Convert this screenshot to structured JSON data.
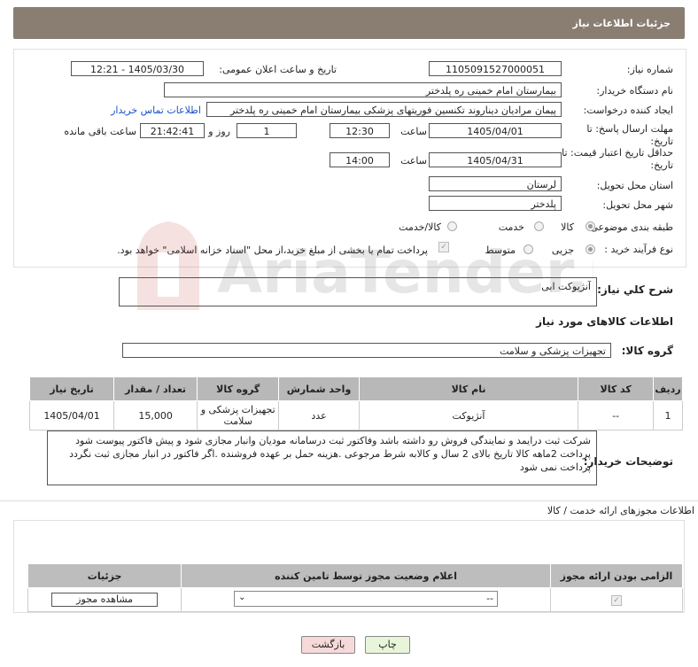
{
  "header": {
    "title": "جزئیات اطلاعات نیاز"
  },
  "fields": {
    "need_number_label": "شماره نیاز:",
    "need_number": "1105091527000051",
    "announce_label": "تاریخ و ساعت اعلان عمومی:",
    "announce_value": "1405/03/30 - 12:21",
    "buyer_org_label": "نام دستگاه خریدار:",
    "buyer_org": "بیمارستان امام خمینی ره پلدختر",
    "creator_label": "ایجاد کننده درخواست:",
    "creator": "پیمان مرادیان دیناروند تکنسین فوریتهای پزشکی بیمارستان امام خمینی ره پلدختر",
    "contact_link": "اطلاعات تماس خریدار",
    "deadline_label": "مهلت ارسال پاسخ: تا تاریخ:",
    "deadline_date": "1405/04/01",
    "time_label": "ساعت",
    "deadline_time": "12:30",
    "days": "1",
    "days_label": "روز و",
    "remaining_time": "21:42:41",
    "remaining_label": "ساعت باقی مانده",
    "price_validity_label": "حداقل تاریخ اعتبار قیمت: تا تاریخ:",
    "validity_date": "1405/04/31",
    "validity_time": "14:00",
    "province_label": "استان محل تحویل:",
    "province": "لرستان",
    "city_label": "شهر محل تحویل:",
    "city": "پلدختر",
    "category_label": "طبقه بندی موضوعی:",
    "category_options": [
      "کالا",
      "خدمت",
      "کالا/خدمت"
    ],
    "process_label": "نوع فرآیند خرید :",
    "process_options": [
      "جزیی",
      "متوسط"
    ],
    "payment_note": "پرداخت تمام یا بخشی از مبلغ خرید،از محل \"اسناد خزانه اسلامی\" خواهد بود."
  },
  "summary": {
    "label": "شرح کلي نياز:",
    "text": "آنژیوکت ابی"
  },
  "goods_info_title": "اطلاعات کالاهای مورد نیاز",
  "goods_group": {
    "label": "گروه کالا:",
    "value": "تجهیزات پزشکی و سلامت"
  },
  "goods_table": {
    "headers": [
      "ردیف",
      "کد کالا",
      "نام کالا",
      "واحد شمارش",
      "گروه کالا",
      "تعداد / مقدار",
      "تاریخ نیاز"
    ],
    "rows": [
      [
        "1",
        "--",
        "آنژیوکت",
        "عدد",
        "تجهیزات پزشکی و سلامت",
        "15,000",
        "1405/04/01"
      ]
    ]
  },
  "buyer_notes": {
    "label": "توضیحات خریدار:",
    "text": "شرکت ثبت درایمد و نمایندگی فروش رو داشته باشد وفاکتور ثبت درسامانه مودیان وانبار مجازی شود و پیش فاکتور پیوست شود پرداخت 2ماهه کالا تاریخ بالای 2 سال و کالابه شرط مرجوعی .هزینه حمل بر عهده فروشنده .اگر فاکتور در انبار مجازی ثبت نگردد پرداخت نمی شود"
  },
  "permits": {
    "title": "اطلاعات مجوزهای ارائه خدمت / کالا",
    "headers": [
      "الزامی بودن ارائه مجوز",
      "اعلام وضعیت مجوز توسط تامین کننده",
      "جزئیات"
    ],
    "select_value": "--",
    "view_button": "مشاهده مجوز"
  },
  "buttons": {
    "print": "چاپ",
    "back": "بازگشت"
  },
  "watermark_text": "AriaTender.neT",
  "colors": {
    "header_bg": "#8a7d72",
    "link": "#1a50c8",
    "back_bg": "#f7d9d9",
    "print_bg": "#e8f5d9"
  }
}
